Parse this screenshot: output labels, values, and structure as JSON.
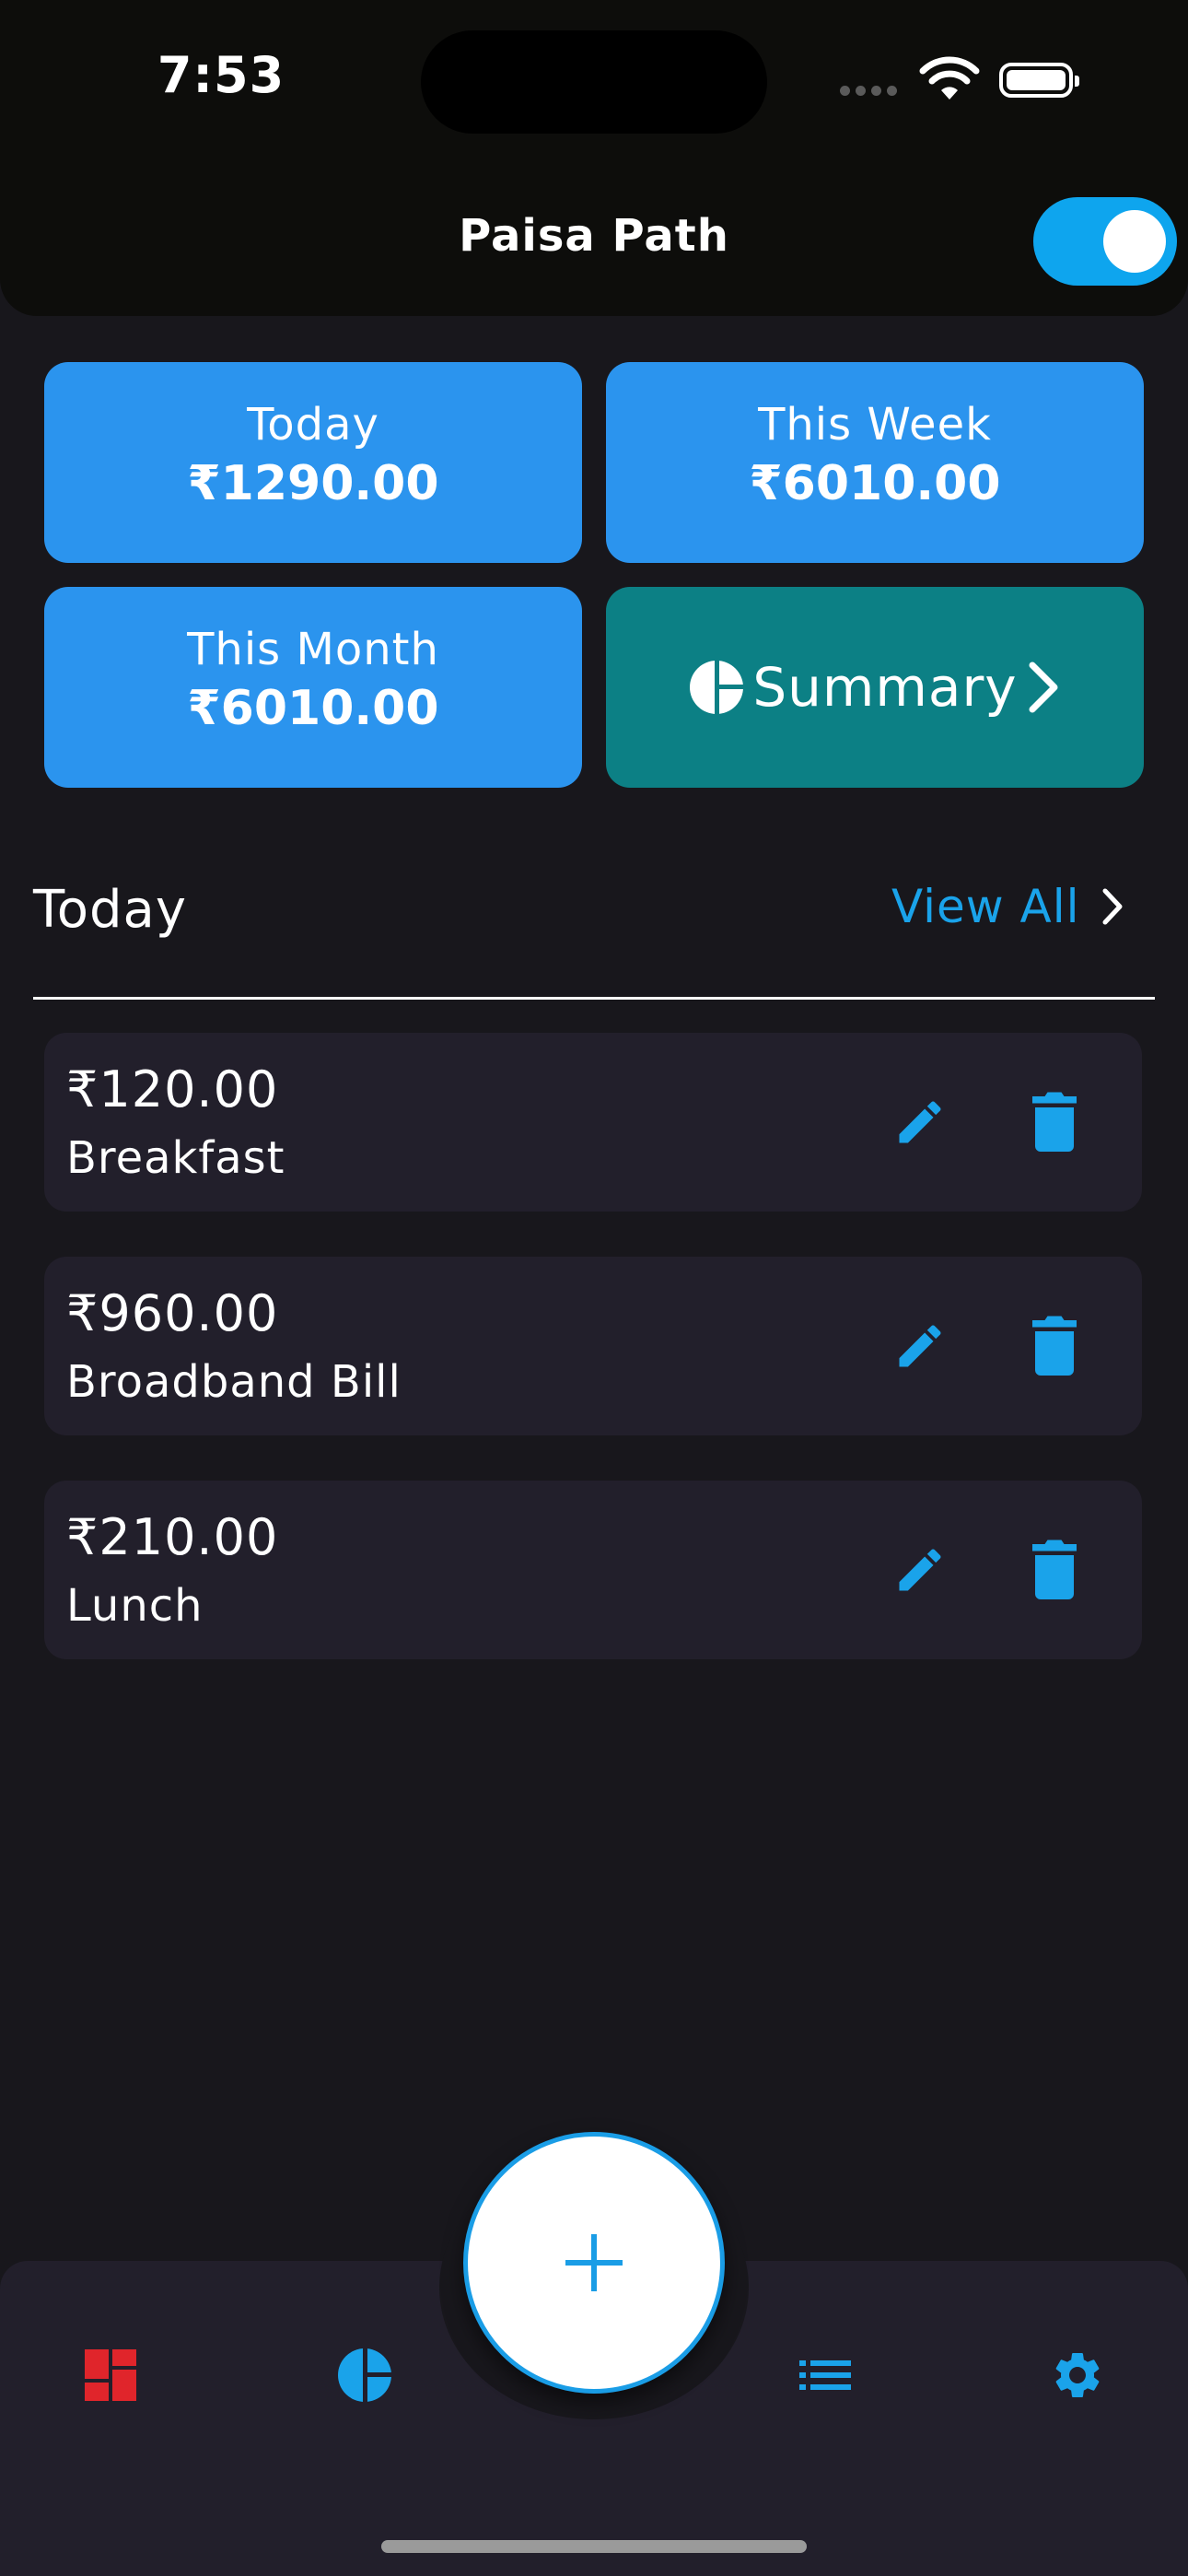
{
  "status_bar": {
    "time": "7:53"
  },
  "header": {
    "title": "Paisa Path",
    "dark_mode_toggle_on": true
  },
  "cards": [
    {
      "label": "Today",
      "amount": "₹1290.00"
    },
    {
      "label": "This Week",
      "amount": "₹6010.00"
    },
    {
      "label": "This Month",
      "amount": "₹6010.00"
    }
  ],
  "summary_button": {
    "label": "Summary",
    "icon": "pie-chart-icon"
  },
  "section": {
    "title": "Today",
    "view_all": "View All"
  },
  "expenses": [
    {
      "amount": "₹120.00",
      "name": "Breakfast"
    },
    {
      "amount": "₹960.00",
      "name": "Broadband Bill"
    },
    {
      "amount": "₹210.00",
      "name": "Lunch"
    }
  ],
  "bottom_nav": {
    "items": [
      "dashboard-icon",
      "pie-chart-icon",
      "add-icon",
      "list-icon",
      "settings-icon"
    ]
  },
  "colors": {
    "accent": "#1aa3ea",
    "card_blue": "#2b94ee",
    "summary_teal": "#0c8085",
    "dashboard_red": "#e0252b",
    "background": "#18171c",
    "item_bg": "#221f2b"
  }
}
